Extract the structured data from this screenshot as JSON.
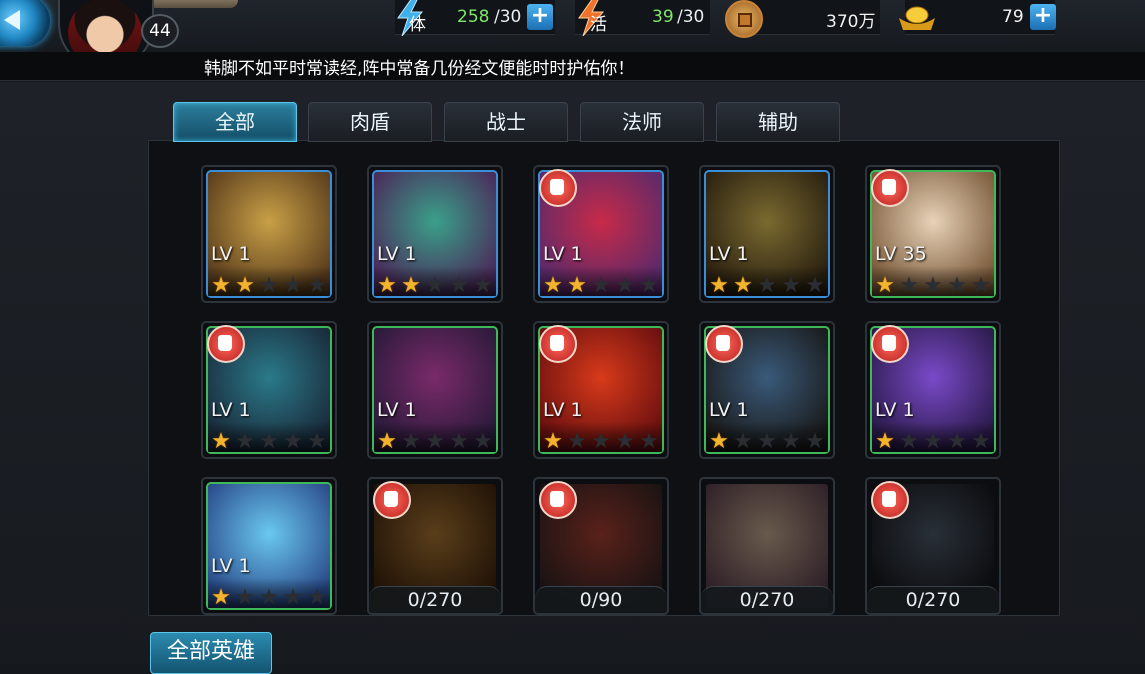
{
  "header": {
    "player_level": "44",
    "stamina": {
      "label": "体",
      "value": "258",
      "max": "/30"
    },
    "energy": {
      "label": "活",
      "value": "39",
      "max": "/30"
    },
    "coins": "370万",
    "ingots": "79"
  },
  "notice": "韩脚不如平时常读经,阵中常备几份经文便能时时护佑你！",
  "tabs": [
    {
      "label": "全部",
      "active": true
    },
    {
      "label": "肉盾",
      "active": false
    },
    {
      "label": "战士",
      "active": false
    },
    {
      "label": "法师",
      "active": false
    },
    {
      "label": "辅助",
      "active": false
    }
  ],
  "heroes": [
    {
      "level": "LV 1",
      "stars": 2,
      "frame": "blue",
      "badge": false,
      "art_colors": [
        "#c9a047",
        "#5a3d1c"
      ]
    },
    {
      "level": "LV 1",
      "stars": 2,
      "frame": "blue",
      "badge": false,
      "art_colors": [
        "#3aa08a",
        "#4a2a5a"
      ]
    },
    {
      "level": "LV 1",
      "stars": 2,
      "frame": "blue",
      "badge": true,
      "art_colors": [
        "#c82a48",
        "#5a2a6a"
      ]
    },
    {
      "level": "LV 1",
      "stars": 2,
      "frame": "blue",
      "badge": false,
      "art_colors": [
        "#7a6a30",
        "#2a2010"
      ]
    },
    {
      "level": "LV 35",
      "stars": 1,
      "frame": "green",
      "badge": true,
      "art_colors": [
        "#e8d2b8",
        "#7a5a3a"
      ]
    },
    {
      "level": "LV 1",
      "stars": 1,
      "frame": "green",
      "badge": true,
      "art_colors": [
        "#2a7a8a",
        "#1a2a3a"
      ]
    },
    {
      "level": "LV 1",
      "stars": 1,
      "frame": "green",
      "badge": false,
      "art_colors": [
        "#7a2a6a",
        "#2a1a3a"
      ]
    },
    {
      "level": "LV 1",
      "stars": 1,
      "frame": "green",
      "badge": true,
      "art_colors": [
        "#d83a1a",
        "#6a1010"
      ]
    },
    {
      "level": "LV 1",
      "stars": 1,
      "frame": "green",
      "badge": true,
      "art_colors": [
        "#3a5a7a",
        "#1a1a1a"
      ]
    },
    {
      "level": "LV 1",
      "stars": 1,
      "frame": "green",
      "badge": true,
      "art_colors": [
        "#7a4ac8",
        "#2a1a4a"
      ]
    },
    {
      "level": "LV 1",
      "stars": 1,
      "frame": "green",
      "badge": false,
      "art_colors": [
        "#6ac8f0",
        "#2a4a8a"
      ]
    },
    {
      "fragments": "0/270",
      "badge": true,
      "art_colors": [
        "#c88a3a",
        "#4a2a10"
      ]
    },
    {
      "fragments": "0/90",
      "badge": true,
      "art_colors": [
        "#c84a3a",
        "#3a2a2a"
      ]
    },
    {
      "fragments": "0/270",
      "badge": false,
      "art_colors": [
        "#e8c8a8",
        "#6a4a5a"
      ]
    },
    {
      "fragments": "0/270",
      "badge": true,
      "art_colors": [
        "#5a6a7a",
        "#1a1a22"
      ]
    }
  ],
  "footer": {
    "all_heroes_label": "全部英雄"
  },
  "colors": {
    "accent": "#3fb6e2",
    "star": "#f4b32c",
    "green_frame": "#3fb85a",
    "blue_frame": "#3a8ed8"
  }
}
